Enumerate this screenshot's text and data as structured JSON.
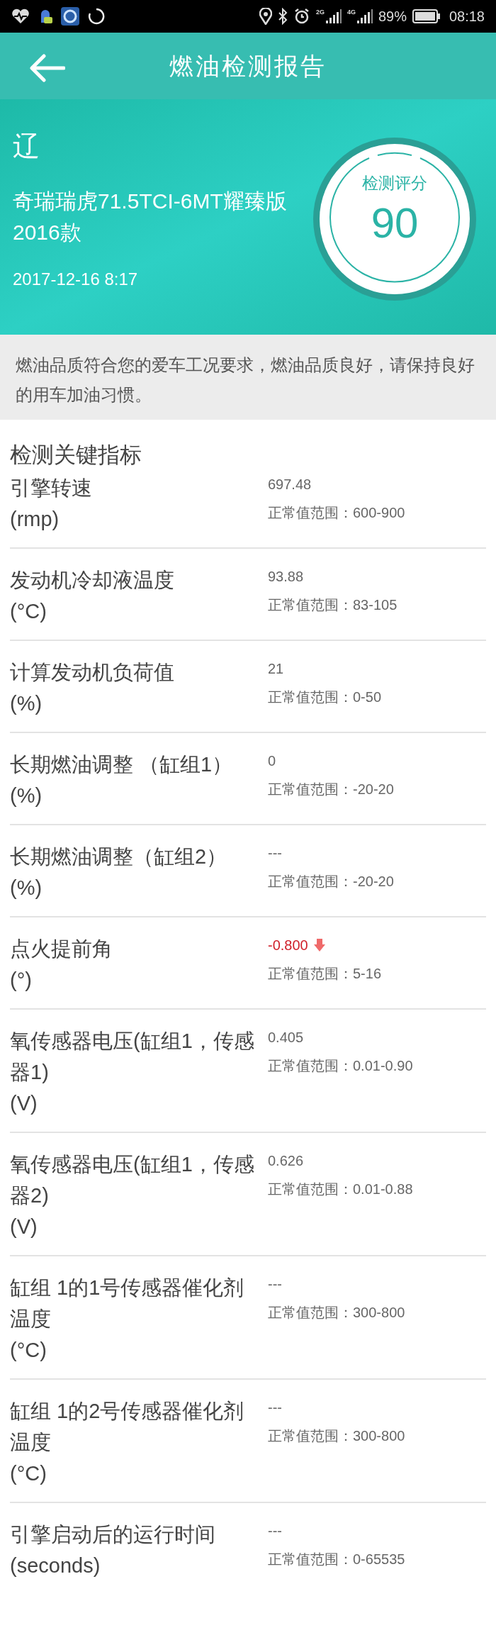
{
  "status_bar": {
    "network_labels": [
      "2G",
      "4G"
    ],
    "battery": "89%",
    "time": "08:18"
  },
  "header": {
    "title": "燃油检测报告"
  },
  "vehicle": {
    "plate": "辽",
    "model": "奇瑞瑞虎71.5TCI-6MT耀臻版2016款",
    "date": "2017-12-16 8:17"
  },
  "score": {
    "label": "检测评分",
    "value": "90"
  },
  "notice": "燃油品质符合您的爱车工况要求，燃油品质良好，请保持良好的用车加油习惯。",
  "indicators": {
    "title": "检测关键指标",
    "items": [
      {
        "name": "引擎转速",
        "unit": "(rmp)",
        "value": "697.48",
        "range": "正常值范围：600-900",
        "out_of_range": false
      },
      {
        "name": "发动机冷却液温度",
        "unit": "(°C)",
        "value": "93.88",
        "range": "正常值范围：83-105",
        "out_of_range": false
      },
      {
        "name": "计算发动机负荷值",
        "unit": "(%)",
        "value": "21",
        "range": "正常值范围：0-50",
        "out_of_range": false
      },
      {
        "name": "长期燃油调整 （缸组1）",
        "unit": "(%)",
        "value": "0",
        "range": "正常值范围：-20-20",
        "out_of_range": false
      },
      {
        "name": "长期燃油调整（缸组2）",
        "unit": "(%)",
        "value": "---",
        "range": "正常值范围：-20-20",
        "out_of_range": false
      },
      {
        "name": "点火提前角",
        "unit": "(°)",
        "value": "-0.800",
        "range": "正常值范围：5-16",
        "out_of_range": true
      },
      {
        "name": "氧传感器电压(缸组1，传感器1)",
        "unit": "(V)",
        "value": "0.405",
        "range": "正常值范围：0.01-0.90",
        "out_of_range": false
      },
      {
        "name": "氧传感器电压(缸组1，传感器2)",
        "unit": "(V)",
        "value": "0.626",
        "range": "正常值范围：0.01-0.88",
        "out_of_range": false
      },
      {
        "name": "缸组 1的1号传感器催化剂温度",
        "unit": "(°C)",
        "value": "---",
        "range": "正常值范围：300-800",
        "out_of_range": false
      },
      {
        "name": "缸组 1的2号传感器催化剂温度",
        "unit": "(°C)",
        "value": "---",
        "range": "正常值范围：300-800",
        "out_of_range": false
      },
      {
        "name": "引擎启动后的运行时间",
        "unit": "(seconds)",
        "value": "---",
        "range": "正常值范围：0-65535",
        "out_of_range": false
      }
    ]
  }
}
